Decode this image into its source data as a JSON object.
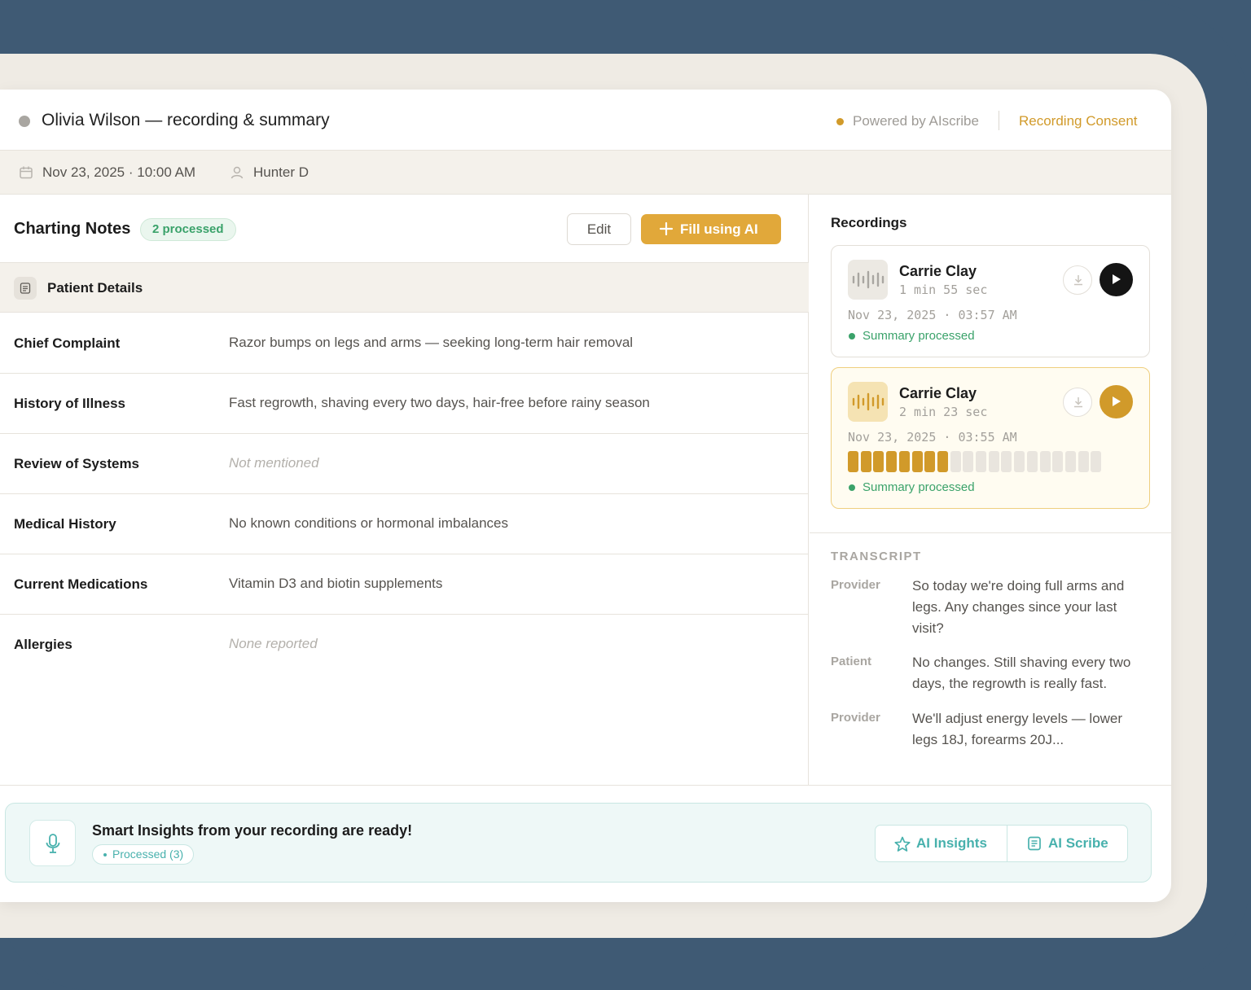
{
  "header": {
    "title": "Olivia Wilson — recording & summary",
    "powered_by": "Powered by AIscribe",
    "consent_link": "Recording Consent"
  },
  "meta": {
    "datetime": "Nov 23, 2025 · 10:00 AM",
    "provider": "Hunter D"
  },
  "charting": {
    "title": "Charting Notes",
    "badge": "2 processed",
    "edit_label": "Edit",
    "fill_label": "Fill using AI",
    "section_title": "Patient Details",
    "fields": [
      {
        "label": "Chief Complaint",
        "value": "Razor bumps on legs and arms — seeking long-term hair removal",
        "muted": false
      },
      {
        "label": "History of Illness",
        "value": "Fast regrowth, shaving every two days, hair-free before rainy season",
        "muted": false
      },
      {
        "label": "Review of Systems",
        "value": "Not mentioned",
        "muted": true
      },
      {
        "label": "Medical History",
        "value": "No known conditions or hormonal imbalances",
        "muted": false
      },
      {
        "label": "Current Medications",
        "value": "Vitamin D3 and biotin supplements",
        "muted": false
      },
      {
        "label": "Allergies",
        "value": "None reported",
        "muted": true
      }
    ]
  },
  "recordings": {
    "title": "Recordings",
    "items": [
      {
        "name": "Carrie Clay",
        "duration": "1 min 55 sec",
        "date": "Nov 23, 2025 · 03:57 AM",
        "status": "Summary processed",
        "playing": false
      },
      {
        "name": "Carrie Clay",
        "duration": "2 min 23 sec",
        "date": "Nov 23, 2025 · 03:55 AM",
        "status": "Summary processed",
        "playing": true,
        "progress_segments": 8,
        "total_segments": 20
      }
    ]
  },
  "transcript": {
    "title": "TRANSCRIPT",
    "lines": [
      {
        "speaker": "Provider",
        "text": "So today we're doing full arms and legs. Any changes since your last visit?"
      },
      {
        "speaker": "Patient",
        "text": "No changes. Still shaving every two days, the regrowth is really fast."
      },
      {
        "speaker": "Provider",
        "text": "We'll adjust energy levels — lower legs 18J, forearms 20J..."
      }
    ]
  },
  "banner": {
    "title": "Smart Insights from your recording are ready!",
    "chip": "Processed (3)",
    "insights_label": "AI Insights",
    "scribe_label": "AI Scribe"
  },
  "colors": {
    "accent": "#e1a83a",
    "gold": "#d19a2a",
    "success": "#3aa26a",
    "teal": "#48b1ad",
    "frame": "#3f5a74"
  },
  "icons": {
    "meta_date": "calendar-icon",
    "meta_user": "user-icon",
    "fill": "plus-icon",
    "section": "document-icon",
    "download": "download-icon",
    "play": "play-icon",
    "waveform": "waveform-icon",
    "mic": "microphone-icon",
    "insights": "star-icon",
    "scribe": "notes-icon"
  }
}
